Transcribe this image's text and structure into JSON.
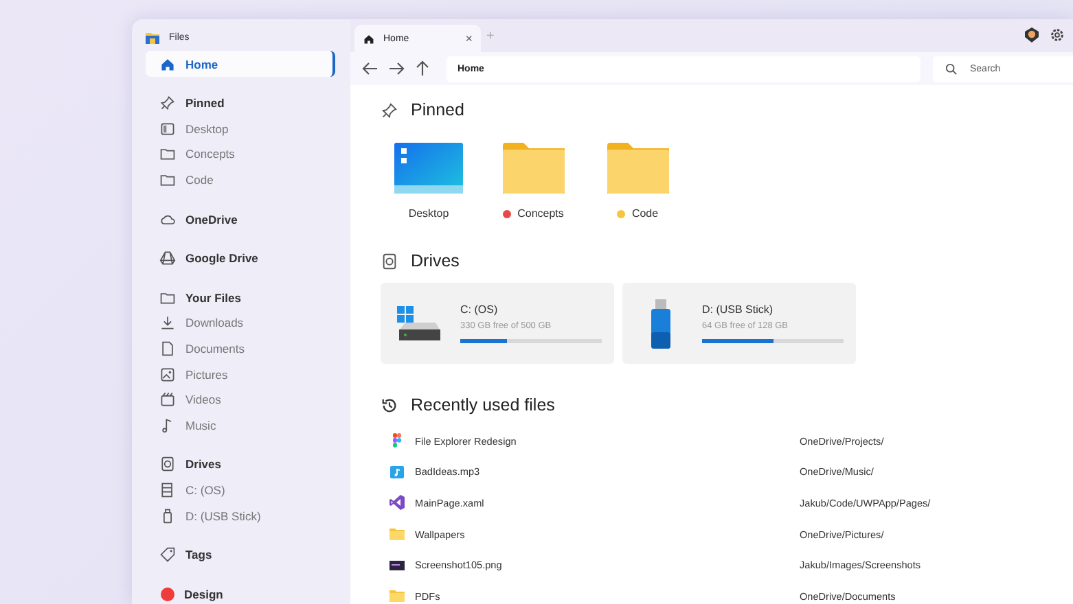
{
  "app": {
    "title": "Files"
  },
  "tabs": [
    {
      "label": "Home",
      "selected": true,
      "close": "×"
    }
  ],
  "new_tab": "+",
  "address": {
    "value": "Home"
  },
  "search": {
    "placeholder": "Search"
  },
  "sidebar": {
    "items": [
      {
        "label": "Home",
        "kind": "header",
        "selected": true
      },
      {
        "label": "Pinned",
        "kind": "header",
        "selected": false
      },
      {
        "label": "Desktop",
        "kind": "item",
        "selected": false
      },
      {
        "label": "Concepts",
        "kind": "item",
        "selected": false
      },
      {
        "label": "Code",
        "kind": "item",
        "selected": false
      },
      {
        "label": "OneDrive",
        "kind": "header",
        "selected": false
      },
      {
        "label": "Google Drive",
        "kind": "header",
        "selected": false
      },
      {
        "label": "Your Files",
        "kind": "header",
        "selected": false
      },
      {
        "label": "Downloads",
        "kind": "item",
        "selected": false
      },
      {
        "label": "Documents",
        "kind": "item",
        "selected": false
      },
      {
        "label": "Pictures",
        "kind": "item",
        "selected": false
      },
      {
        "label": "Videos",
        "kind": "item",
        "selected": false
      },
      {
        "label": "Music",
        "kind": "item",
        "selected": false
      },
      {
        "label": "Drives",
        "kind": "header",
        "selected": false
      },
      {
        "label": "C: (OS)",
        "kind": "item",
        "selected": false
      },
      {
        "label": "D: (USB Stick)",
        "kind": "item",
        "selected": false
      },
      {
        "label": "Tags",
        "kind": "header",
        "selected": false
      },
      {
        "label": "Design",
        "kind": "tag",
        "selected": false,
        "color": "#ee3b3b"
      }
    ]
  },
  "pinned": {
    "title": "Pinned",
    "items": [
      {
        "label": "Desktop",
        "kind": "desktop"
      },
      {
        "label": "Concepts",
        "kind": "folder",
        "color": "#e94848"
      },
      {
        "label": "Code",
        "kind": "folder",
        "color": "#f4c63d"
      }
    ]
  },
  "drives": {
    "title": "Drives",
    "items": [
      {
        "name": "C: (OS)",
        "kind": "disk",
        "free": "330 GB free of 500 GB",
        "level": 0.33
      },
      {
        "name": "D: (USB Stick)",
        "kind": "usb",
        "free": "64 GB free of 128 GB",
        "level": 0.5
      }
    ]
  },
  "recent": {
    "title": "Recently used files",
    "files": [
      {
        "name": "File Explorer Redesign",
        "path": "OneDrive/Projects/",
        "kind": "design"
      },
      {
        "name": "BadIdeas.mp3",
        "path": "OneDrive/Music/",
        "kind": "audio"
      },
      {
        "name": "MainPage.xaml",
        "path": "Jakub/Code/UWPApp/Pages/",
        "kind": "code"
      },
      {
        "name": "Wallpapers",
        "path": "OneDrive/Pictures/",
        "kind": "folder"
      },
      {
        "name": "Screenshot105.png",
        "path": "Jakub/Images/Screenshots",
        "kind": "image"
      },
      {
        "name": "PDFs",
        "path": "OneDrive/Documents",
        "kind": "folder"
      }
    ]
  }
}
